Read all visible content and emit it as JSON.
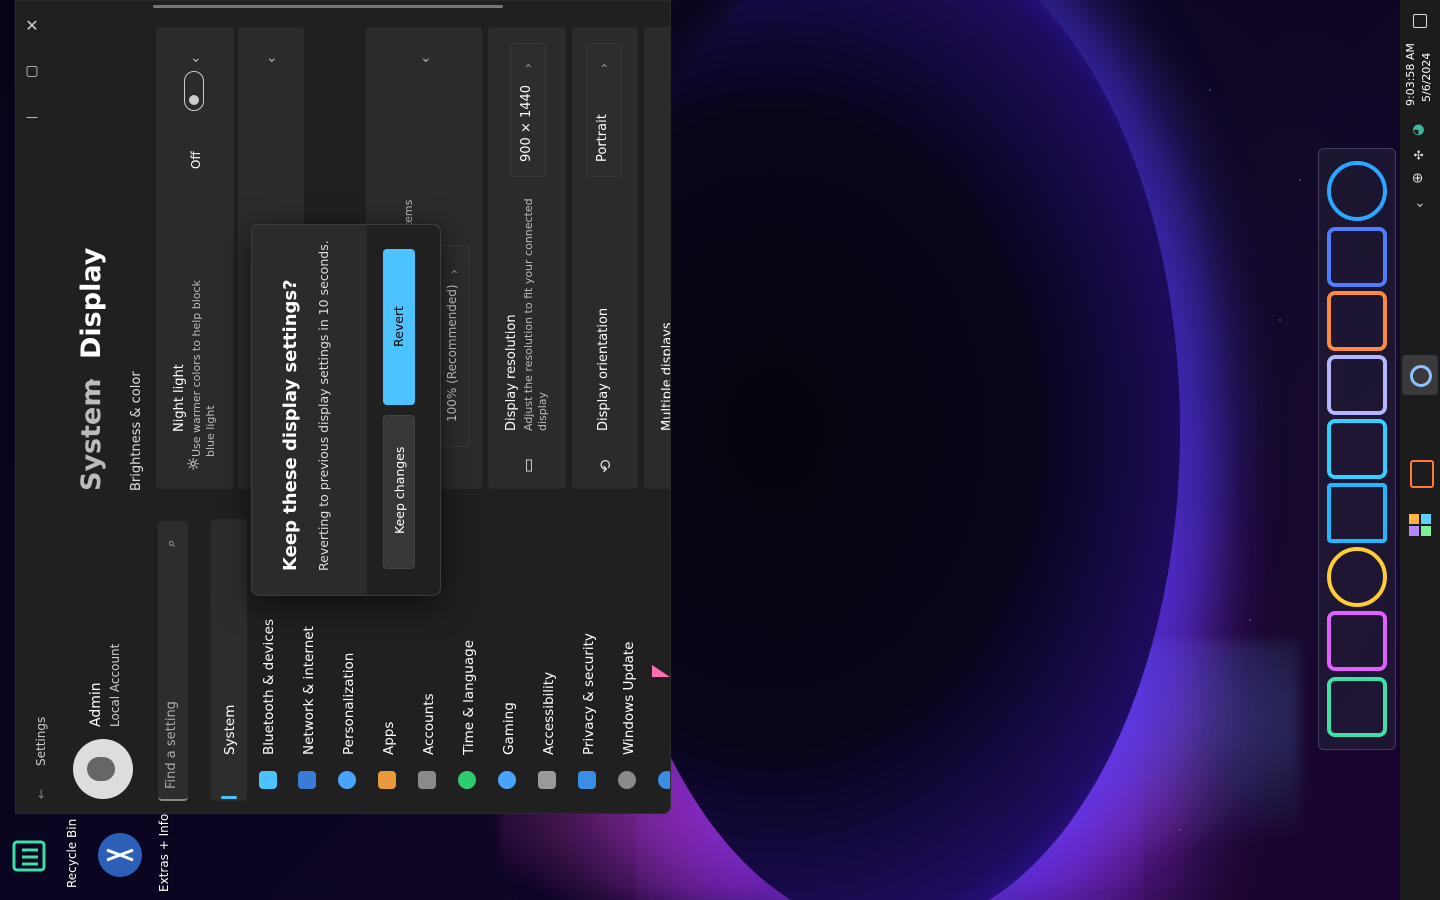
{
  "desktop": {
    "recycle_bin_label": "Recycle Bin",
    "extras_label": "Extras + Info"
  },
  "window": {
    "app_title": "Settings",
    "controls": {
      "close": "✕",
      "maximize": "▢",
      "minimize": "—"
    },
    "user": {
      "name": "Admin",
      "account_type": "Local Account"
    },
    "search": {
      "placeholder": "Find a setting"
    },
    "breadcrumb": {
      "parent": "System",
      "separator": "›",
      "current": "Display"
    },
    "section_label": "Brightness & color",
    "nav": [
      {
        "label": "System",
        "icon": "system-icon",
        "color": "#4cc2ff",
        "selected": true
      },
      {
        "label": "Bluetooth & devices",
        "icon": "bluetooth-icon",
        "color": "#3a7bd5"
      },
      {
        "label": "Network & internet",
        "icon": "network-icon",
        "color": "#4aa3ff"
      },
      {
        "label": "Personalization",
        "icon": "brush-icon",
        "color": "#e89a3c"
      },
      {
        "label": "Apps",
        "icon": "apps-icon",
        "color": "#8a8a8a"
      },
      {
        "label": "Accounts",
        "icon": "accounts-icon",
        "color": "#2ecc71"
      },
      {
        "label": "Time & language",
        "icon": "globe-clock-icon",
        "color": "#4aa3ff"
      },
      {
        "label": "Gaming",
        "icon": "gamepad-icon",
        "color": "#9a9a9a"
      },
      {
        "label": "Accessibility",
        "icon": "accessibility-icon",
        "color": "#3a8ee6"
      },
      {
        "label": "Privacy & security",
        "icon": "shield-icon",
        "color": "#8a8a8a"
      },
      {
        "label": "Windows Update",
        "icon": "update-icon",
        "color": "#3a8ee6"
      }
    ],
    "night_light": {
      "title": "Night light",
      "description": "Use warmer colors to help block blue light",
      "toggle_state": "Off"
    },
    "scale": {
      "value": "100% (Recommended)",
      "partial_label": "er items"
    },
    "resolution": {
      "title": "Display resolution",
      "description": "Adjust the resolution to fit your connected display",
      "value": "900 × 1440"
    },
    "orientation": {
      "title": "Display orientation",
      "value": "Portrait"
    },
    "multiple_displays": {
      "title": "Multiple displays"
    }
  },
  "dialog": {
    "title": "Keep these display settings?",
    "message": "Reverting to previous display settings in 10 seconds.",
    "keep_label": "Keep changes",
    "revert_label": "Revert"
  },
  "taskbar": {
    "time": "9:03:58 AM",
    "date": "5/6/2024"
  }
}
